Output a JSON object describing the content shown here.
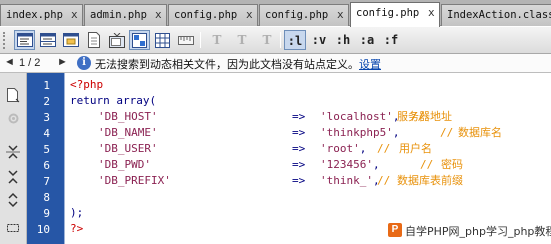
{
  "tabs": [
    {
      "label": "index.php",
      "close": "x",
      "active": false
    },
    {
      "label": "admin.php",
      "close": "x",
      "active": false
    },
    {
      "label": "config.php",
      "close": "x",
      "active": false
    },
    {
      "label": "config.php",
      "close": "x",
      "active": false
    },
    {
      "label": "config.php",
      "close": "x",
      "active": true
    },
    {
      "label": "IndexAction.class",
      "close": "",
      "active": false
    }
  ],
  "toolbar": {
    "icons": [
      "code-view-icon",
      "split-view-icon",
      "design-view-icon",
      "document-icon",
      "tv-icon",
      "grid-icon",
      "table-icon",
      "ruler-icon"
    ],
    "text_buttons": [
      {
        "label": "T",
        "style": "dim"
      },
      {
        "label": "T",
        "style": "dim"
      },
      {
        "label": "T",
        "style": "dim"
      },
      {
        "label": ":l",
        "style": "selected"
      },
      {
        "label": ":v",
        "style": "normal"
      },
      {
        "label": ":h",
        "style": "normal"
      },
      {
        "label": ":a",
        "style": "normal"
      },
      {
        "label": ":f",
        "style": "normal"
      }
    ]
  },
  "infobar": {
    "prev_arrow": "◄",
    "next_arrow": "►",
    "page_indicator": "1 / 2",
    "message": "无法搜索到动态相关文件，因为此文档没有站点定义。",
    "link": "设置"
  },
  "gutter": {
    "line_numbers": [
      "1",
      "2",
      "3",
      "4",
      "5",
      "6",
      "7",
      "8",
      "9",
      "10"
    ]
  },
  "code": {
    "open_tag": "<?php",
    "return_line": "return array(",
    "entries": [
      {
        "key": "'DB_HOST'",
        "arrow": "=>",
        "value": "'localhost'",
        "comment": "//",
        "note": "服务器地址"
      },
      {
        "key": "'DB_NAME'",
        "arrow": "=>",
        "value": "'thinkphp5'",
        "comment": "//",
        "note": "数据库名"
      },
      {
        "key": "'DB_USER'",
        "arrow": "=>",
        "value": "'root'",
        "comment": "//",
        "note": "用户名"
      },
      {
        "key": "'DB_PWD'",
        "arrow": "=>",
        "value": "'123456'",
        "comment": "//",
        "note": "密码"
      },
      {
        "key": "'DB_PREFIX'",
        "arrow": "=>",
        "value": "'think_'",
        "comment": "//",
        "note": "数据库表前缀"
      }
    ],
    "close_line": ");",
    "close_tag": "?>"
  },
  "watermark": {
    "logo": "P",
    "text": "自学PHP网_php学习_php教程"
  },
  "colors": {
    "gutter": "#2656a6",
    "php_tag": "#cc0000",
    "keyword": "#000080",
    "string": "#8b2252",
    "comment": "#e8910a",
    "link": "#0645ad"
  }
}
